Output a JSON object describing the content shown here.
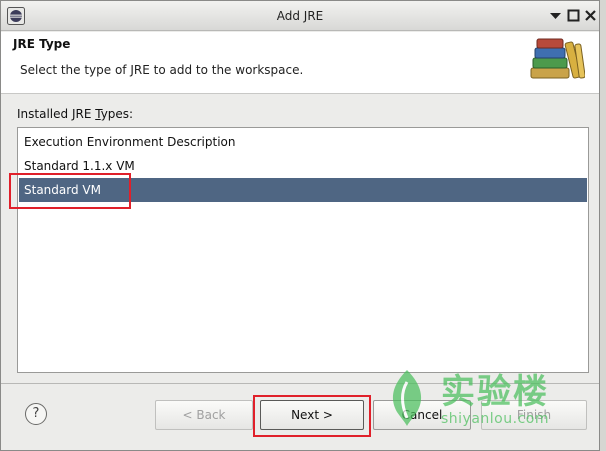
{
  "window": {
    "title": "Add JRE",
    "controls": [
      "minimize-icon",
      "maximize-icon",
      "close-icon"
    ]
  },
  "header": {
    "title": "JRE Type",
    "description": "Select the type of JRE to add to the workspace."
  },
  "list": {
    "label_prefix": "Installed JRE ",
    "label_mnemonic": "T",
    "label_suffix": "ypes:",
    "items": [
      {
        "label": "Execution Environment Description",
        "selected": false
      },
      {
        "label": "Standard 1.1.x VM",
        "selected": false
      },
      {
        "label": "Standard VM",
        "selected": true
      }
    ]
  },
  "buttons": {
    "help": "?",
    "back_label": "< Back",
    "next_label": "Next >",
    "cancel_label": "Cancel",
    "finish_label": "Finish"
  },
  "watermark": {
    "cn": "实验楼",
    "en": "shiyanlou.com"
  },
  "colors": {
    "selection": "#4f6683",
    "annotation": "#e0202a",
    "watermark": "#4bbf5d"
  }
}
